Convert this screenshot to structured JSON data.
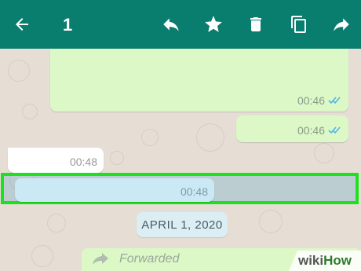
{
  "toolbar": {
    "selected_count": "1",
    "icons": [
      "back-arrow-icon",
      "reply-icon",
      "star-icon",
      "delete-icon",
      "copy-icon",
      "forward-icon"
    ],
    "color": "#0a7e6e"
  },
  "messages": [
    {
      "type": "outgoing",
      "time": "00:46",
      "status": "double-check-blue"
    },
    {
      "type": "outgoing",
      "time": "00:46",
      "status": "double-check-blue"
    },
    {
      "type": "incoming",
      "time": "00:48"
    },
    {
      "type": "incoming-selected",
      "time": "00:48"
    }
  ],
  "date_separator": "APRIL 1, 2020",
  "forwarded_label": "Forwarded",
  "watermark": {
    "wiki": "wiki",
    "how": "How"
  },
  "colors": {
    "selection_border": "#1ee11e",
    "outgoing_bubble": "#dcf8c6",
    "tick_blue": "#4fb6ec"
  }
}
